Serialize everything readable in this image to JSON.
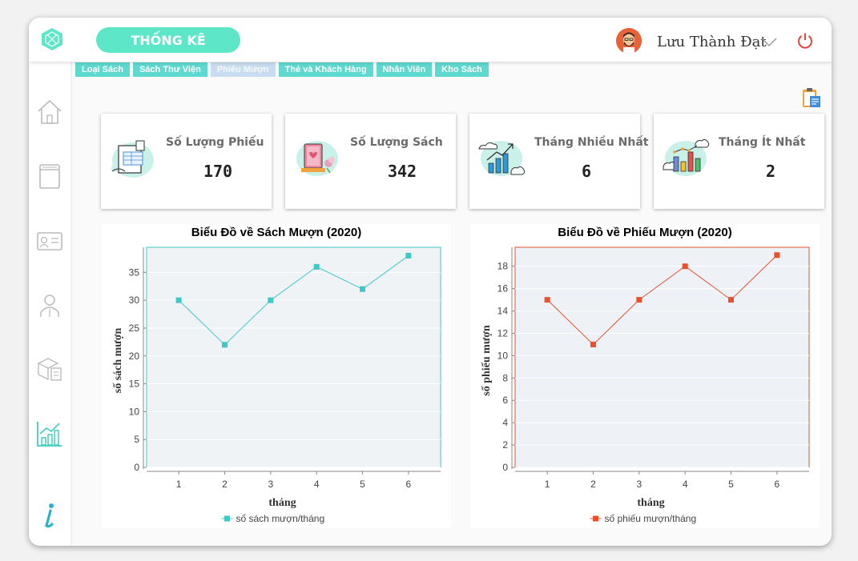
{
  "header": {
    "title": "THỐNG KÊ",
    "user_name": "Lưu Thành Đạt"
  },
  "tabs": [
    {
      "label": "Loại Sách",
      "active": false
    },
    {
      "label": "Sách Thư Viện",
      "active": false
    },
    {
      "label": "Phiếu Mượn",
      "active": true
    },
    {
      "label": "Thẻ và Khách Hàng",
      "active": false
    },
    {
      "label": "Nhân Viên",
      "active": false
    },
    {
      "label": "Kho Sách",
      "active": false
    }
  ],
  "sidebar": {
    "items": [
      {
        "icon": "home-icon"
      },
      {
        "icon": "book-icon"
      },
      {
        "icon": "id-card-icon"
      },
      {
        "icon": "employee-icon"
      },
      {
        "icon": "warehouse-icon"
      },
      {
        "icon": "statistics-icon",
        "active": true
      },
      {
        "icon": "info-icon"
      }
    ]
  },
  "cards": [
    {
      "label": "Số Lượng Phiếu",
      "value": "170",
      "icon": "ticket-icon"
    },
    {
      "label": "Số Lượng Sách",
      "value": "342",
      "icon": "books-icon"
    },
    {
      "label": "Tháng Nhiều Nhất",
      "value": "6",
      "icon": "rising-chart-icon"
    },
    {
      "label": "Tháng Ít Nhất",
      "value": "2",
      "icon": "bar-chart-icon"
    }
  ],
  "colors": {
    "accent": "#5ee6c8",
    "series_books": "#3ec8c8",
    "series_tickets": "#e8502e"
  },
  "chart_data": [
    {
      "type": "line",
      "title": "Biểu Đồ về Sách Mượn (2020)",
      "xlabel": "tháng",
      "ylabel": "số sách mượn",
      "x": [
        1,
        2,
        3,
        4,
        5,
        6
      ],
      "series": [
        {
          "name": "số sách mượn/tháng",
          "values": [
            30,
            22,
            30,
            36,
            32,
            38
          ]
        }
      ],
      "yticks": [
        0,
        5,
        10,
        15,
        20,
        25,
        30,
        35
      ],
      "ylim": [
        0,
        39.5
      ],
      "xlim": [
        0.3,
        6.7
      ],
      "grid": true,
      "legend": "bottom"
    },
    {
      "type": "line",
      "title": "Biểu Đồ về Phiếu Mượn (2020)",
      "xlabel": "tháng",
      "ylabel": "số phiếu mượn",
      "x": [
        1,
        2,
        3,
        4,
        5,
        6
      ],
      "series": [
        {
          "name": "số phiếu mượn/tháng",
          "values": [
            15,
            11,
            15,
            18,
            15,
            19
          ]
        }
      ],
      "yticks": [
        0,
        2,
        4,
        6,
        8,
        10,
        12,
        14,
        16,
        18
      ],
      "ylim": [
        0,
        19.7
      ],
      "xlim": [
        0.3,
        6.7
      ],
      "grid": true,
      "legend": "bottom"
    }
  ]
}
